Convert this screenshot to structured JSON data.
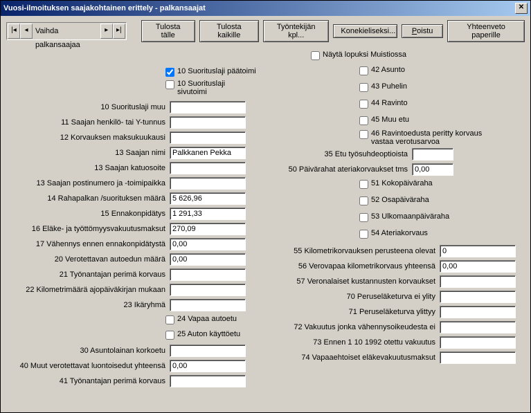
{
  "window": {
    "title": "Vuosi-ilmoituksen saajakohtainen erittely - palkansaajat"
  },
  "nav": {
    "label": "Vaihda palkansaajaa"
  },
  "toolbar": {
    "btn_tulosta_talle": "Tulosta tälle",
    "btn_tulosta_kaikille": "Tulosta kaikille",
    "btn_tyontekijan": "Työntekijän kpl...",
    "btn_konekieliseksi": "Konekieliseksi...",
    "btn_poistu": "Poistu",
    "btn_yhteenveto": "Yhteenveto paperille"
  },
  "checkboxes": {
    "nayta_lopuksi": "Näytä lopuksi Muistiossa",
    "suorituslaji_paatoimi": "10 Suorituslaji päätoimi",
    "suorituslaji_sivutoimi": "10 Suorituslaji sivutoimi",
    "vapaa_autoetu": "24 Vapaa autoetu",
    "auton_kayttoetu": "25 Auton käyttöetu",
    "asunto": "42 Asunto",
    "puhelin": "43 Puhelin",
    "ravinto": "44 Ravinto",
    "muu_etu": "45 Muu etu",
    "ravintoedusta": "46 Ravintoedusta peritty korvaus vastaa verotusarvoa",
    "kokopaivaraha": "51 Kokopäiväraha",
    "osapaivaraha": "52 Osapäiväraha",
    "ulkomaanpaivaraha": "53 Ulkomaanpäiväraha",
    "ateriakorvaus": "54 Ateriakorvaus"
  },
  "checkbox_values": {
    "suorituslaji_paatoimi": true
  },
  "left": {
    "f10": "10 Suorituslaji muu",
    "f11": "11 Saajan henkilö- tai Y-tunnus",
    "f12": "12 Korvauksen maksukuukausi",
    "f13": "13 Saajan nimi",
    "f13k": "13 Saajan katuosoite",
    "f13p": "13 Saajan postinumero ja -toimipaikka",
    "f14": "14 Rahapalkan /suorituksen määrä",
    "f15": "15 Ennakonpidätys",
    "f16": "16 Eläke- ja työttömyysvakuutusmaksut",
    "f17": "17 Vähennys ennen ennakonpidätystä",
    "f20": "20 Verotettavan autoedun määrä",
    "f21": "21 Työnantajan perimä korvaus",
    "f22": "22 Kilometrimäärä ajopäiväkirjan mukaan",
    "f23": "23 Ikäryhmä",
    "f30": "30 Asuntolainan korkoetu",
    "f40": "40 Muut verotettavat luontoisedut yhteensä",
    "f41": "41 Työnantajan perimä korvaus"
  },
  "right": {
    "f35": "35 Etu työsuhdeoptioista",
    "f50": "50 Päivärahat ateriakorvaukset tms",
    "f55": "55 Kilometrikorvauksen perusteena olevat",
    "f56": "56 Verovapaa kilometrikorvaus yhteensä",
    "f57": "57 Veronalaiset kustannusten korvaukset",
    "f70": "70 Peruseläketurva ei ylity",
    "f71": "71 Peruseläketurva ylittyy",
    "f72": "72 Vakuutus jonka vähennysoikeudesta ei",
    "f73": "73 Ennen 1 10 1992 otettu vakuutus",
    "f74": "74 Vapaaehtoiset eläkevakuutusmaksut"
  },
  "values": {
    "f13": "Palkkanen Pekka",
    "f14": "5 626,96",
    "f15": "1 291,33",
    "f16": "270,09",
    "f17": "0,00",
    "f20": "0,00",
    "f40": "0,00",
    "f50": "0,00",
    "f55": "0",
    "f56": "0,00"
  }
}
